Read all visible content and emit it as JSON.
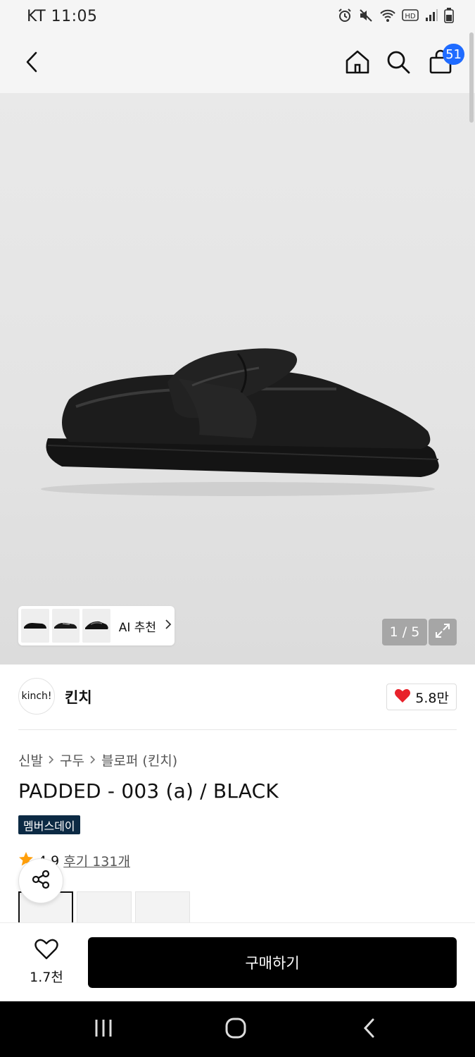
{
  "status_bar": {
    "time": "KT 11:05",
    "icons": [
      "alarm-icon",
      "mute-icon",
      "wifi-icon",
      "hd-icon",
      "signal-icon",
      "battery-icon"
    ]
  },
  "header": {
    "icons": [
      "back-icon",
      "home-icon",
      "search-icon",
      "cart-icon"
    ],
    "cart_count": "51"
  },
  "gallery": {
    "ai_label": "AI 추천",
    "counter": "1 / 5"
  },
  "brand": {
    "logo_text": "kinch!",
    "name": "킨치",
    "likes": "5.8만"
  },
  "breadcrumb": [
    "신발",
    "구두",
    "블로퍼 (킨치)"
  ],
  "product": {
    "title": "PADDED - 003 (a) / BLACK",
    "badge": "멤버스데이",
    "rating": "4.9",
    "reviews": "후기 131개"
  },
  "bottom_bar": {
    "wish_count": "1.7천",
    "buy_label": "구매하기"
  },
  "colors": {
    "accent_blue": "#1f6bff",
    "badge_navy": "#0c2a44",
    "heart_red": "#e8222b",
    "star_orange": "#ff9f0a",
    "buy_black": "#000000"
  }
}
